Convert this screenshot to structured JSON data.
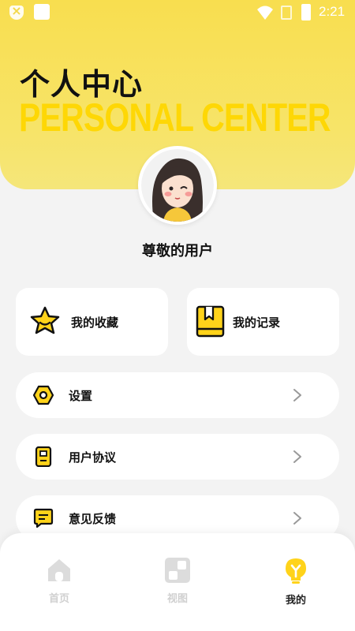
{
  "status_bar": {
    "time": "2:21"
  },
  "header": {
    "title_cn": "个人中心",
    "title_en": "PERSONAL CENTER"
  },
  "profile": {
    "username": "尊敬的用户"
  },
  "cards": {
    "favorites": {
      "label": "我的收藏",
      "icon": "star-icon"
    },
    "records": {
      "label": "我的记录",
      "icon": "bookmark-book-icon"
    }
  },
  "menu": [
    {
      "label": "设置",
      "icon": "hex-nut-icon"
    },
    {
      "label": "用户协议",
      "icon": "document-icon"
    },
    {
      "label": "意见反馈",
      "icon": "chat-bubble-icon"
    }
  ],
  "bottom_nav": {
    "items": [
      {
        "label": "首页",
        "icon": "home-icon",
        "active": false
      },
      {
        "label": "视图",
        "icon": "grid-icon",
        "active": false
      },
      {
        "label": "我的",
        "icon": "lightbulb-icon",
        "active": true
      }
    ]
  },
  "colors": {
    "accent": "#f8de4f",
    "icon_yellow": "#ffd31a",
    "background": "#f3f3f3",
    "inactive_nav": "#d8d8d8"
  }
}
